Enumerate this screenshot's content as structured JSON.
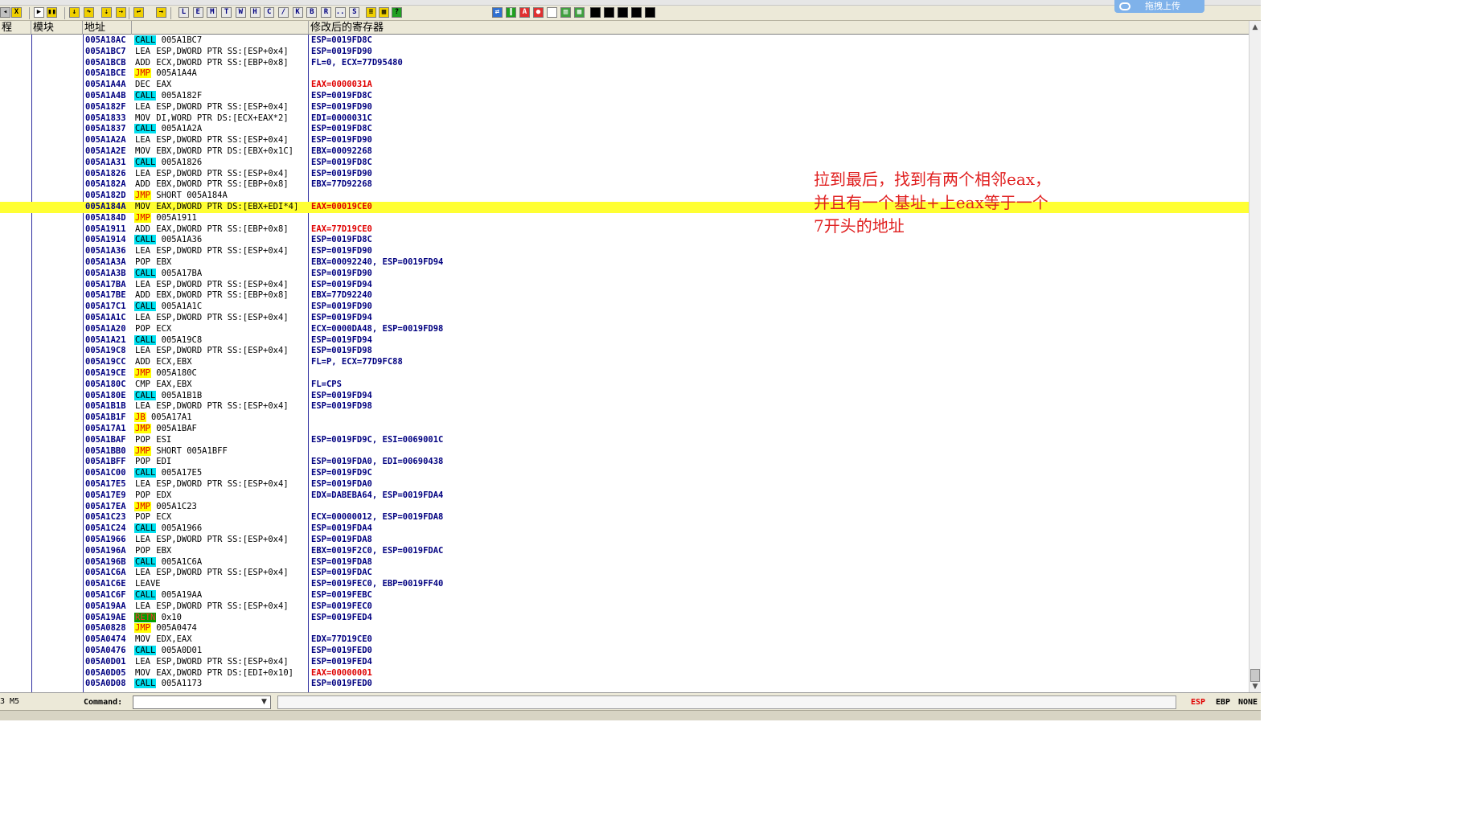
{
  "toolbar": {
    "letters": [
      "L",
      "E",
      "M",
      "T",
      "W",
      "H",
      "C",
      "/",
      "K",
      "B",
      "R",
      "...",
      "S"
    ]
  },
  "upload_badge": {
    "label": "拖拽上传"
  },
  "header": {
    "col_thread": "程",
    "col_module": "模块",
    "col_address": "地址",
    "col_instruction": "",
    "col_registers": "修改后的寄存器"
  },
  "colors": {
    "highlight": "#ffff33",
    "call_bg": "#00e0f0",
    "jmp_bg": "#ffff00",
    "jmp_fg": "#e00000",
    "retn_bg": "#00a000",
    "address": "#000080",
    "register_changed": "#e00000",
    "note": "#e02020"
  },
  "trace": [
    {
      "addr": "005A18AC",
      "op": "CALL",
      "args": "005A1BC7",
      "regs": "ESP=0019FD8C",
      "kind": "call"
    },
    {
      "addr": "005A1BC7",
      "op": "LEA",
      "args": "ESP,DWORD PTR SS:[ESP+0x4]",
      "regs": "ESP=0019FD90"
    },
    {
      "addr": "005A1BCB",
      "op": "ADD",
      "args": "ECX,DWORD PTR SS:[EBP+0x8]",
      "regs": "FL=0, ECX=77D95480"
    },
    {
      "addr": "005A1BCE",
      "op": "JMP",
      "args": "005A1A4A",
      "regs": "",
      "kind": "jmp"
    },
    {
      "addr": "005A1A4A",
      "op": "DEC",
      "args": "EAX",
      "regs": "EAX=0000031A",
      "red": true
    },
    {
      "addr": "005A1A4B",
      "op": "CALL",
      "args": "005A182F",
      "regs": "ESP=0019FD8C",
      "kind": "call"
    },
    {
      "addr": "005A182F",
      "op": "LEA",
      "args": "ESP,DWORD PTR SS:[ESP+0x4]",
      "regs": "ESP=0019FD90"
    },
    {
      "addr": "005A1833",
      "op": "MOV",
      "args": "DI,WORD PTR DS:[ECX+EAX*2]",
      "regs": "EDI=0000031C"
    },
    {
      "addr": "005A1837",
      "op": "CALL",
      "args": "005A1A2A",
      "regs": "ESP=0019FD8C",
      "kind": "call"
    },
    {
      "addr": "005A1A2A",
      "op": "LEA",
      "args": "ESP,DWORD PTR SS:[ESP+0x4]",
      "regs": "ESP=0019FD90"
    },
    {
      "addr": "005A1A2E",
      "op": "MOV",
      "args": "EBX,DWORD PTR DS:[EBX+0x1C]",
      "regs": "EBX=00092268"
    },
    {
      "addr": "005A1A31",
      "op": "CALL",
      "args": "005A1826",
      "regs": "ESP=0019FD8C",
      "kind": "call"
    },
    {
      "addr": "005A1826",
      "op": "LEA",
      "args": "ESP,DWORD PTR SS:[ESP+0x4]",
      "regs": "ESP=0019FD90"
    },
    {
      "addr": "005A182A",
      "op": "ADD",
      "args": "EBX,DWORD PTR SS:[EBP+0x8]",
      "regs": "EBX=77D92268"
    },
    {
      "addr": "005A182D",
      "op": "JMP",
      "args": "SHORT 005A184A",
      "regs": "",
      "kind": "jmp"
    },
    {
      "addr": "005A184A",
      "op": "MOV",
      "args": "EAX,DWORD PTR DS:[EBX+EDI*4]",
      "regs": "EAX=00019CE0",
      "red": true,
      "highlight": true
    },
    {
      "addr": "005A184D",
      "op": "JMP",
      "args": "005A1911",
      "regs": "",
      "kind": "jmp"
    },
    {
      "addr": "005A1911",
      "op": "ADD",
      "args": "EAX,DWORD PTR SS:[EBP+0x8]",
      "regs": "EAX=77D19CE0",
      "red": true
    },
    {
      "addr": "005A1914",
      "op": "CALL",
      "args": "005A1A36",
      "regs": "ESP=0019FD8C",
      "kind": "call"
    },
    {
      "addr": "005A1A36",
      "op": "LEA",
      "args": "ESP,DWORD PTR SS:[ESP+0x4]",
      "regs": "ESP=0019FD90"
    },
    {
      "addr": "005A1A3A",
      "op": "POP",
      "args": "EBX",
      "regs": "EBX=00092240, ESP=0019FD94"
    },
    {
      "addr": "005A1A3B",
      "op": "CALL",
      "args": "005A17BA",
      "regs": "ESP=0019FD90",
      "kind": "call"
    },
    {
      "addr": "005A17BA",
      "op": "LEA",
      "args": "ESP,DWORD PTR SS:[ESP+0x4]",
      "regs": "ESP=0019FD94"
    },
    {
      "addr": "005A17BE",
      "op": "ADD",
      "args": "EBX,DWORD PTR SS:[EBP+0x8]",
      "regs": "EBX=77D92240"
    },
    {
      "addr": "005A17C1",
      "op": "CALL",
      "args": "005A1A1C",
      "regs": "ESP=0019FD90",
      "kind": "call"
    },
    {
      "addr": "005A1A1C",
      "op": "LEA",
      "args": "ESP,DWORD PTR SS:[ESP+0x4]",
      "regs": "ESP=0019FD94"
    },
    {
      "addr": "005A1A20",
      "op": "POP",
      "args": "ECX",
      "regs": "ECX=0000DA48, ESP=0019FD98"
    },
    {
      "addr": "005A1A21",
      "op": "CALL",
      "args": "005A19C8",
      "regs": "ESP=0019FD94",
      "kind": "call"
    },
    {
      "addr": "005A19C8",
      "op": "LEA",
      "args": "ESP,DWORD PTR SS:[ESP+0x4]",
      "regs": "ESP=0019FD98"
    },
    {
      "addr": "005A19CC",
      "op": "ADD",
      "args": "ECX,EBX",
      "regs": "FL=P, ECX=77D9FC88"
    },
    {
      "addr": "005A19CE",
      "op": "JMP",
      "args": "005A180C",
      "regs": "",
      "kind": "jmp"
    },
    {
      "addr": "005A180C",
      "op": "CMP",
      "args": "EAX,EBX",
      "regs": "FL=CPS"
    },
    {
      "addr": "005A180E",
      "op": "CALL",
      "args": "005A1B1B",
      "regs": "ESP=0019FD94",
      "kind": "call"
    },
    {
      "addr": "005A1B1B",
      "op": "LEA",
      "args": "ESP,DWORD PTR SS:[ESP+0x4]",
      "regs": "ESP=0019FD98"
    },
    {
      "addr": "005A1B1F",
      "op": "JB",
      "args": "005A17A1",
      "regs": "",
      "kind": "jmp"
    },
    {
      "addr": "005A17A1",
      "op": "JMP",
      "args": "005A1BAF",
      "regs": "",
      "kind": "jmp"
    },
    {
      "addr": "005A1BAF",
      "op": "POP",
      "args": "ESI",
      "regs": "ESP=0019FD9C, ESI=0069001C"
    },
    {
      "addr": "005A1BB0",
      "op": "JMP",
      "args": "SHORT 005A1BFF",
      "regs": "",
      "kind": "jmp"
    },
    {
      "addr": "005A1BFF",
      "op": "POP",
      "args": "EDI",
      "regs": "ESP=0019FDA0, EDI=00690438"
    },
    {
      "addr": "005A1C00",
      "op": "CALL",
      "args": "005A17E5",
      "regs": "ESP=0019FD9C",
      "kind": "call"
    },
    {
      "addr": "005A17E5",
      "op": "LEA",
      "args": "ESP,DWORD PTR SS:[ESP+0x4]",
      "regs": "ESP=0019FDA0"
    },
    {
      "addr": "005A17E9",
      "op": "POP",
      "args": "EDX",
      "regs": "EDX=DABEBA64, ESP=0019FDA4"
    },
    {
      "addr": "005A17EA",
      "op": "JMP",
      "args": "005A1C23",
      "regs": "",
      "kind": "jmp"
    },
    {
      "addr": "005A1C23",
      "op": "POP",
      "args": "ECX",
      "regs": "ECX=00000012, ESP=0019FDA8"
    },
    {
      "addr": "005A1C24",
      "op": "CALL",
      "args": "005A1966",
      "regs": "ESP=0019FDA4",
      "kind": "call"
    },
    {
      "addr": "005A1966",
      "op": "LEA",
      "args": "ESP,DWORD PTR SS:[ESP+0x4]",
      "regs": "ESP=0019FDA8"
    },
    {
      "addr": "005A196A",
      "op": "POP",
      "args": "EBX",
      "regs": "EBX=0019F2C0, ESP=0019FDAC"
    },
    {
      "addr": "005A196B",
      "op": "CALL",
      "args": "005A1C6A",
      "regs": "ESP=0019FDA8",
      "kind": "call"
    },
    {
      "addr": "005A1C6A",
      "op": "LEA",
      "args": "ESP,DWORD PTR SS:[ESP+0x4]",
      "regs": "ESP=0019FDAC"
    },
    {
      "addr": "005A1C6E",
      "op": "LEAVE",
      "args": "",
      "regs": "ESP=0019FEC0, EBP=0019FF40"
    },
    {
      "addr": "005A1C6F",
      "op": "CALL",
      "args": "005A19AA",
      "regs": "ESP=0019FEBC",
      "kind": "call"
    },
    {
      "addr": "005A19AA",
      "op": "LEA",
      "args": "ESP,DWORD PTR SS:[ESP+0x4]",
      "regs": "ESP=0019FEC0"
    },
    {
      "addr": "005A19AE",
      "op": "RETN",
      "args": "0x10",
      "regs": "ESP=0019FED4",
      "kind": "retn"
    },
    {
      "addr": "005A0828",
      "op": "JMP",
      "args": "005A0474",
      "regs": "",
      "kind": "jmp"
    },
    {
      "addr": "005A0474",
      "op": "MOV",
      "args": "EDX,EAX",
      "regs": "EDX=77D19CE0"
    },
    {
      "addr": "005A0476",
      "op": "CALL",
      "args": "005A0D01",
      "regs": "ESP=0019FED0",
      "kind": "call"
    },
    {
      "addr": "005A0D01",
      "op": "LEA",
      "args": "ESP,DWORD PTR SS:[ESP+0x4]",
      "regs": "ESP=0019FED4"
    },
    {
      "addr": "005A0D05",
      "op": "MOV",
      "args": "EAX,DWORD PTR DS:[EDI+0x10]",
      "regs": "EAX=00000001",
      "red": true
    },
    {
      "addr": "005A0D08",
      "op": "CALL",
      "args": "005A1173",
      "regs": "ESP=0019FED0",
      "kind": "call"
    }
  ],
  "note": {
    "lines": [
      "拉到最后，找到有两个相邻eax，",
      "并且有一个基址+上eax等于一个",
      "7开头的地址"
    ]
  },
  "command_bar": {
    "status_left": "3 M5",
    "label": "Command:",
    "input_value": "",
    "reg_esp": "ESP",
    "reg_ebp": "EBP",
    "reg_none": "NONE"
  }
}
